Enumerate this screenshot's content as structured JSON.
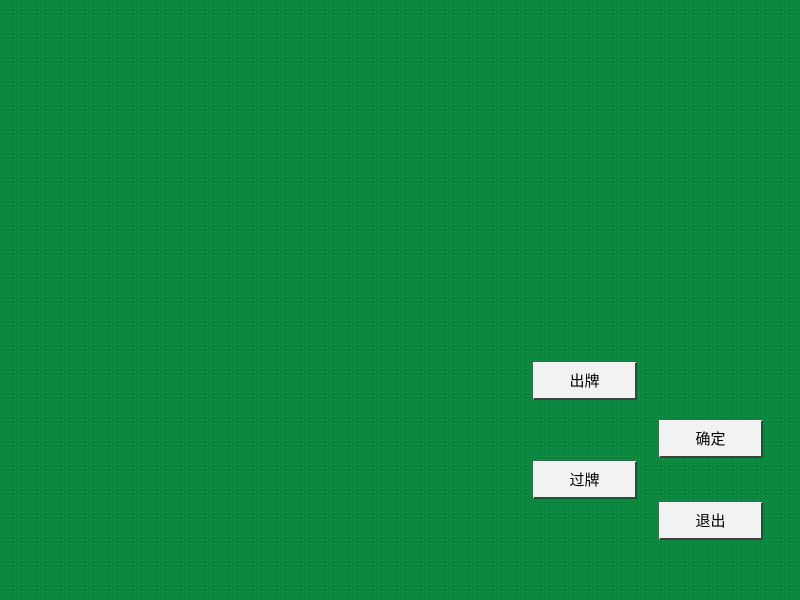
{
  "table": {
    "felt_color": "#0a8a3f"
  },
  "buttons": {
    "play": "出牌",
    "confirm": "确定",
    "pass": "过牌",
    "exit": "退出"
  }
}
